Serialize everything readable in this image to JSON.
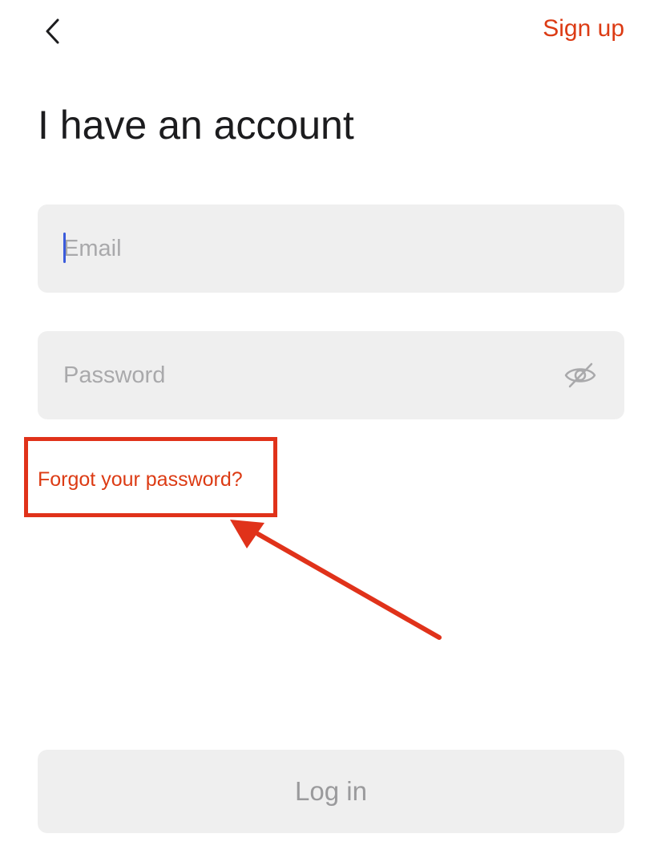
{
  "header": {
    "back_icon": "chevron-left-icon",
    "signup_label": "Sign up"
  },
  "title": "I have an account",
  "form": {
    "email": {
      "value": "",
      "placeholder": "Email"
    },
    "password": {
      "value": "",
      "placeholder": "Password",
      "toggle_icon": "eye-off-icon"
    },
    "forgot_label": "Forgot your password?",
    "login_label": "Log in"
  },
  "colors": {
    "accent": "#dc3b14",
    "annotation": "#e0321a",
    "field_bg": "#efefef",
    "caret": "#3b5bdb"
  }
}
